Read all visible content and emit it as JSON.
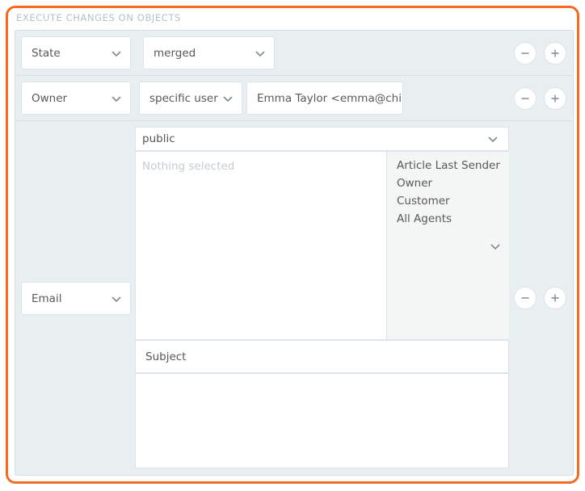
{
  "section_title": "EXECUTE CHANGES ON OBJECTS",
  "rows": {
    "state": {
      "attribute": "State",
      "value": "merged"
    },
    "owner": {
      "attribute": "Owner",
      "mode": "specific user",
      "user": "Emma Taylor <emma@chi"
    },
    "email": {
      "attribute": "Email",
      "visibility": "public",
      "recipients_placeholder": "Nothing selected",
      "recipient_options": [
        "Article Last Sender",
        "Owner",
        "Customer",
        "All Agents"
      ],
      "subject_placeholder": "Subject",
      "body": ""
    }
  },
  "icons": {
    "remove": "minus-circle-icon",
    "add": "plus-circle-icon",
    "dropdown": "chevron-down-icon"
  },
  "colors": {
    "accent": "#f36b21",
    "panel": "#e9eef0",
    "title": "#b0c3cc"
  }
}
